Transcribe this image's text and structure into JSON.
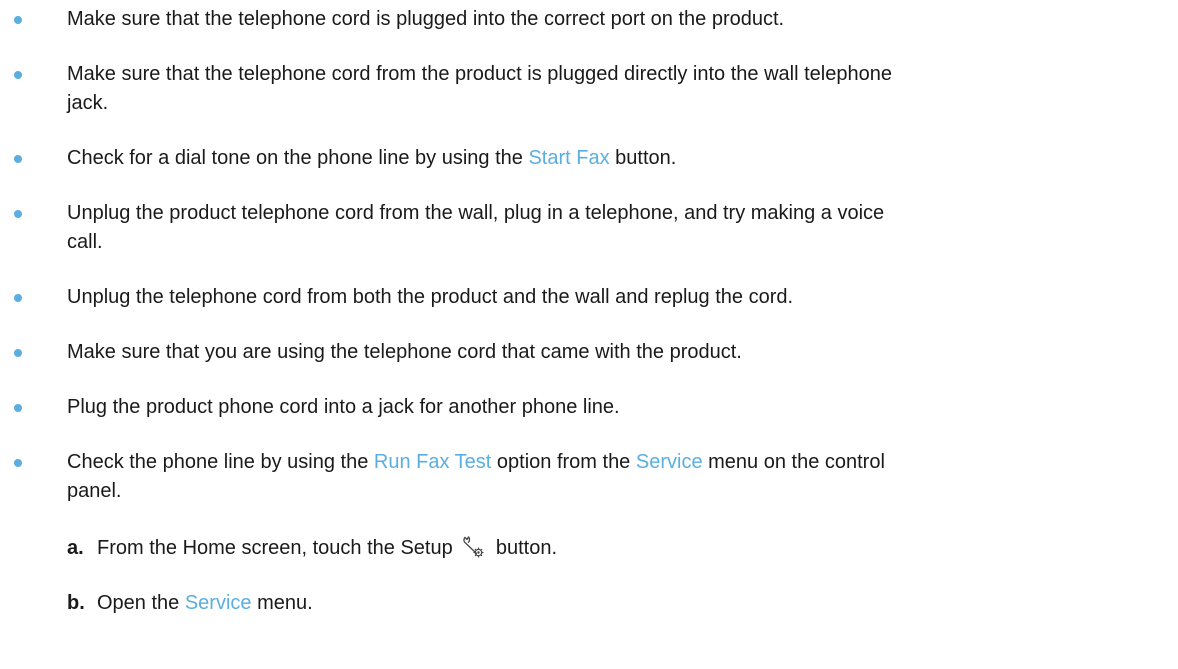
{
  "colors": {
    "bullet": "#5aaee0",
    "link": "#5aaee0",
    "text": "#1a1a1a"
  },
  "bullets": [
    {
      "text": "Make sure that the telephone cord is plugged into the correct port on the product."
    },
    {
      "line1": "Make sure that the telephone cord from the product is plugged directly into the wall telephone",
      "line2": "jack."
    },
    {
      "before": "Check for a dial tone on the phone line by using the ",
      "link": "Start Fax",
      "after": " button."
    },
    {
      "line1": "Unplug the product telephone cord from the wall, plug in a telephone, and try making a voice",
      "line2": "call."
    },
    {
      "text": "Unplug the telephone cord from both the product and the wall and replug the cord."
    },
    {
      "text": "Make sure that you are using the telephone cord that came with the product."
    },
    {
      "text": "Plug the product phone cord into a jack for another phone line."
    },
    {
      "before": "Check the phone line by using the ",
      "link1": "Run Fax Test",
      "middle": " option from the ",
      "link2": "Service",
      "after": " menu on the control",
      "line2": "panel."
    }
  ],
  "steps": [
    {
      "letter": "a.",
      "before": "From the Home screen, touch the Setup ",
      "icon": "setup-wrench-gear-icon",
      "after": " button."
    },
    {
      "letter": "b.",
      "before": "Open the ",
      "link": "Service",
      "after": " menu."
    }
  ]
}
